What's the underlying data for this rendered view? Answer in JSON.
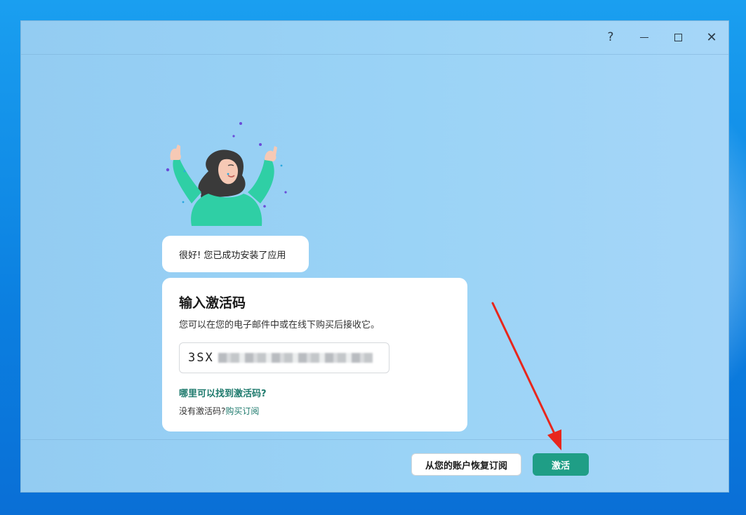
{
  "window": {
    "help_symbol": "?",
    "close_symbol": "✕"
  },
  "bubble": {
    "text": "很好! 您已成功安装了应用"
  },
  "activation": {
    "title": "输入激活码",
    "description": "您可以在您的电子邮件中或在线下购买后接收它。",
    "code_prefix": "3SX",
    "find_code_link": "哪里可以找到激活码?",
    "no_code_text": "没有激活码?",
    "buy_link": "购买订阅"
  },
  "footer": {
    "restore_button": "从您的账户恢复订阅",
    "activate_button": "激活"
  },
  "colors": {
    "accent": "#1f9e86",
    "link": "#1e7a6d",
    "annotation_arrow": "#e8261c"
  }
}
